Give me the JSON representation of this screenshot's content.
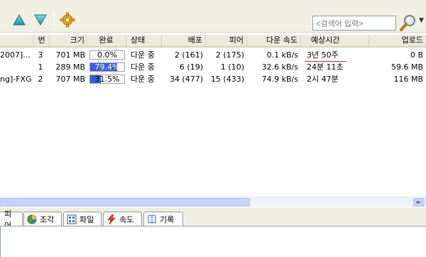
{
  "toolbar": {
    "search_placeholder": "<검색어 입력>"
  },
  "columns": [
    "번",
    "크기",
    "완료",
    "상태",
    "배포",
    "피어",
    "다운 속도",
    "예상시간",
    "업로드"
  ],
  "rows": [
    {
      "name": "2007]...",
      "num": "3",
      "size": "701 MB",
      "progress": 0.0,
      "progress_text": "0.0%",
      "status": "다운 중",
      "seeds": "2 (161)",
      "peers": "2 (175)",
      "down_speed": "0.1 kB/s",
      "eta": "3년 50주",
      "upload": "0 B"
    },
    {
      "name": "",
      "num": "1",
      "size": "289 MB",
      "progress": 79.4,
      "progress_text": "79.4%",
      "status": "다운 중",
      "seeds": "6 (19)",
      "peers": "1 (10)",
      "down_speed": "32.6 kB/s",
      "eta": "24분 11초",
      "upload": "59.6 MB"
    },
    {
      "name": "ng]-FXG",
      "num": "2",
      "size": "707 MB",
      "progress": 31.5,
      "progress_text": "31.5%",
      "status": "다운 중",
      "seeds": "34 (477)",
      "peers": "15 (433)",
      "down_speed": "74.9 kB/s",
      "eta": "2시 47분",
      "upload": "116 MB"
    }
  ],
  "tabs": [
    {
      "label": "피어",
      "icon": "peers-icon"
    },
    {
      "label": "조각",
      "icon": "pieces-icon"
    },
    {
      "label": "파일",
      "icon": "files-icon"
    },
    {
      "label": "속도",
      "icon": "speed-icon"
    },
    {
      "label": "기록",
      "icon": "log-icon"
    }
  ],
  "colors": {
    "progress_fill": "#3b5fd9",
    "eta_underline": "#e02020",
    "scroll_thumb": "#c3d3fd"
  }
}
